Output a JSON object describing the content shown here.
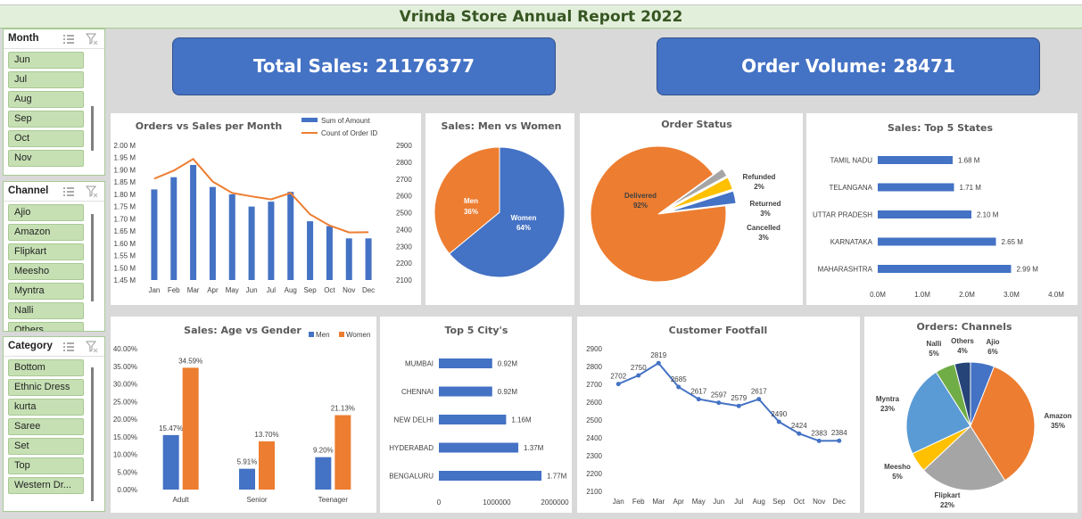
{
  "title": "Vrinda Store Annual Report 2022",
  "slicers": {
    "month": {
      "title": "Month",
      "items": [
        "Jun",
        "Jul",
        "Aug",
        "Sep",
        "Oct",
        "Nov"
      ]
    },
    "channel": {
      "title": "Channel",
      "items": [
        "Ajio",
        "Amazon",
        "Flipkart",
        "Meesho",
        "Myntra",
        "Nalli",
        "Others"
      ]
    },
    "category": {
      "title": "Category",
      "items": [
        "Bottom",
        "Ethnic Dress",
        "kurta",
        "Saree",
        "Set",
        "Top",
        "Western Dr..."
      ]
    }
  },
  "kpis": {
    "total_sales": "Total Sales: 21176377",
    "order_volume": "Order Volume: 28471"
  },
  "colors": {
    "blue": "#4472c4",
    "orange": "#ed7d31",
    "gray": "#a5a5a5",
    "yellow": "#ffc000",
    "lightblue": "#5b9bd5",
    "green": "#70ad47",
    "navy": "#264478"
  },
  "chart_data": [
    {
      "id": "orders_vs_sales",
      "type": "bar",
      "title": "Orders vs Sales per Month",
      "categories": [
        "Jan",
        "Feb",
        "Mar",
        "Apr",
        "May",
        "Jun",
        "Jul",
        "Aug",
        "Sep",
        "Oct",
        "Nov",
        "Dec"
      ],
      "series": [
        {
          "name": "Sum of Amount",
          "type": "bar",
          "axis": "left",
          "values": [
            1.82,
            1.87,
            1.92,
            1.83,
            1.8,
            1.75,
            1.77,
            1.81,
            1.69,
            1.67,
            1.62,
            1.62
          ]
        },
        {
          "name": "Count of Order ID",
          "type": "line",
          "axis": "right",
          "values": [
            2702,
            2750,
            2819,
            2685,
            2617,
            2597,
            2579,
            2617,
            2490,
            2424,
            2383,
            2384
          ]
        }
      ],
      "ylim": [
        1.45,
        2.0
      ],
      "y_ticks": [
        "2.00 M",
        "1.95 M",
        "1.90 M",
        "1.85 M",
        "1.80 M",
        "1.75 M",
        "1.70 M",
        "1.65 M",
        "1.60 M",
        "1.55 M",
        "1.50 M",
        "1.45 M"
      ],
      "y2lim": [
        2100,
        2900
      ],
      "y2_ticks": [
        "2900",
        "2800",
        "2700",
        "2600",
        "2500",
        "2400",
        "2300",
        "2200",
        "2100"
      ],
      "legend": "top-right"
    },
    {
      "id": "men_vs_women",
      "type": "pie",
      "title": "Sales: Men vs Women",
      "labels": [
        "Women",
        "Men"
      ],
      "values": [
        64,
        36
      ],
      "value_labels": [
        "64%",
        "36%"
      ]
    },
    {
      "id": "order_status",
      "type": "pie",
      "title": "Order Status",
      "labels": [
        "Delivered",
        "Refunded",
        "Returned",
        "Cancelled"
      ],
      "values": [
        92,
        2,
        3,
        3
      ],
      "value_labels": [
        "92%",
        "2%",
        "3%",
        "3%"
      ]
    },
    {
      "id": "top5_states",
      "type": "bar",
      "orientation": "horizontal",
      "title": "Sales: Top 5 States",
      "categories": [
        "TAMIL NADU",
        "TELANGANA",
        "UTTAR PRADESH",
        "KARNATAKA",
        "MAHARASHTRA"
      ],
      "values": [
        1.68,
        1.71,
        2.1,
        2.65,
        2.99
      ],
      "value_labels": [
        "1.68 M",
        "1.71 M",
        "2.10 M",
        "2.65 M",
        "2.99 M"
      ],
      "xlim": [
        0,
        4
      ],
      "x_ticks": [
        "0.0M",
        "1.0M",
        "2.0M",
        "3.0M",
        "4.0M"
      ]
    },
    {
      "id": "age_vs_gender",
      "type": "bar",
      "title": "Sales: Age vs Gender",
      "categories": [
        "Adult",
        "Senior",
        "Teenager"
      ],
      "series": [
        {
          "name": "Men",
          "values": [
            15.47,
            5.91,
            9.2
          ],
          "value_labels": [
            "15.47%",
            "5.91%",
            "9.20%"
          ]
        },
        {
          "name": "Women",
          "values": [
            34.59,
            13.7,
            21.13
          ],
          "value_labels": [
            "34.59%",
            "13.70%",
            "21.13%"
          ]
        }
      ],
      "ylim": [
        0,
        40
      ],
      "y_ticks": [
        "40.00%",
        "35.00%",
        "30.00%",
        "25.00%",
        "20.00%",
        "15.00%",
        "10.00%",
        "5.00%",
        "0.00%"
      ],
      "legend": "top-right"
    },
    {
      "id": "top5_cities",
      "type": "bar",
      "orientation": "horizontal",
      "title": "Top 5 City's",
      "categories": [
        "MUMBAI",
        "CHENNAI",
        "NEW DELHI",
        "HYDERABAD",
        "BENGALURU"
      ],
      "values": [
        0.92,
        0.92,
        1.16,
        1.37,
        1.77
      ],
      "value_labels": [
        "0.92M",
        "0.92M",
        "1.16M",
        "1.37M",
        "1.77M"
      ],
      "xlim": [
        0,
        2000000
      ],
      "x_ticks": [
        "0",
        "1000000",
        "2000000"
      ]
    },
    {
      "id": "customer_footfall",
      "type": "line",
      "title": "Customer Footfall",
      "categories": [
        "Jan",
        "Feb",
        "Mar",
        "Apr",
        "May",
        "Jun",
        "Jul",
        "Aug",
        "Sep",
        "Oct",
        "Nov",
        "Dec"
      ],
      "values": [
        2702,
        2750,
        2819,
        2685,
        2617,
        2597,
        2579,
        2617,
        2490,
        2424,
        2383,
        2384
      ],
      "ylim": [
        2100,
        2900
      ],
      "y_ticks": [
        "2900",
        "2800",
        "2700",
        "2600",
        "2500",
        "2400",
        "2300",
        "2200",
        "2100"
      ]
    },
    {
      "id": "channels",
      "type": "pie",
      "title": "Orders: Channels",
      "labels": [
        "Ajio",
        "Amazon",
        "Flipkart",
        "Meesho",
        "Myntra",
        "Nalli",
        "Others"
      ],
      "values": [
        6,
        35,
        22,
        5,
        23,
        5,
        4
      ],
      "value_labels": [
        "6%",
        "35%",
        "22%",
        "5%",
        "23%",
        "5%",
        "4%"
      ]
    }
  ]
}
